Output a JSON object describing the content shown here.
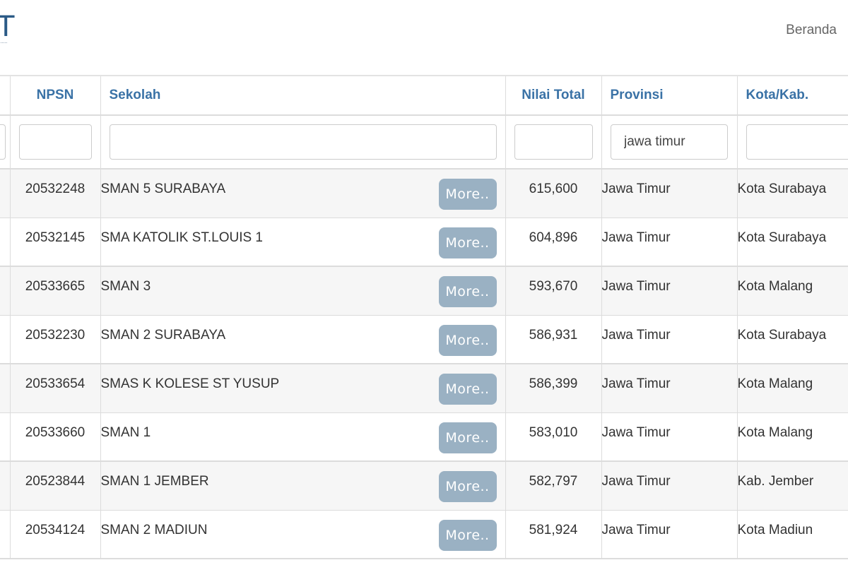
{
  "header": {
    "logo_letter": "T",
    "nav_home_label": "Beranda"
  },
  "table": {
    "columns": [
      "",
      "NPSN",
      "Sekolah",
      "Nilai Total",
      "Provinsi",
      "Kota/Kab."
    ],
    "filters": {
      "npsn": "",
      "sekolah": "",
      "nilai_total": "",
      "provinsi": "jawa timur",
      "kota": ""
    },
    "more_label": "More..",
    "rows": [
      {
        "npsn": "20532248",
        "sekolah": "SMAN 5 SURABAYA",
        "nilai": "615,600",
        "provinsi": "Jawa Timur",
        "kota": "Kota Surabaya"
      },
      {
        "npsn": "20532145",
        "sekolah": "SMA KATOLIK ST.LOUIS 1",
        "nilai": "604,896",
        "provinsi": "Jawa Timur",
        "kota": "Kota Surabaya"
      },
      {
        "npsn": "20533665",
        "sekolah": "SMAN 3",
        "nilai": "593,670",
        "provinsi": "Jawa Timur",
        "kota": "Kota Malang"
      },
      {
        "npsn": "20532230",
        "sekolah": "SMAN 2 SURABAYA",
        "nilai": "586,931",
        "provinsi": "Jawa Timur",
        "kota": "Kota Surabaya"
      },
      {
        "npsn": "20533654",
        "sekolah": "SMAS K KOLESE ST YUSUP",
        "nilai": "586,399",
        "provinsi": "Jawa Timur",
        "kota": "Kota Malang"
      },
      {
        "npsn": "20533660",
        "sekolah": "SMAN 1",
        "nilai": "583,010",
        "provinsi": "Jawa Timur",
        "kota": "Kota Malang"
      },
      {
        "npsn": "20523844",
        "sekolah": "SMAN 1 JEMBER",
        "nilai": "582,797",
        "provinsi": "Jawa Timur",
        "kota": "Kab. Jember"
      },
      {
        "npsn": "20534124",
        "sekolah": "SMAN 2 MADIUN",
        "nilai": "581,924",
        "provinsi": "Jawa Timur",
        "kota": "Kota Madiun"
      }
    ]
  }
}
